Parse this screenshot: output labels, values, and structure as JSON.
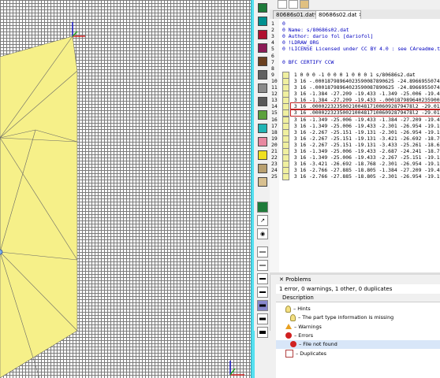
{
  "palette": {
    "colors": [
      "#1e7b3a",
      "#009090",
      "#b01030",
      "#8b1a56",
      "#6b4020",
      "#606060",
      "#8a8a8a",
      "#585858",
      "#5ca03c",
      "#20b4b4",
      "#e888a0",
      "#f0e020",
      "#b8a070",
      "#d8c090"
    ],
    "tools": [
      {
        "name": "green-color-button",
        "color": "#1e7b3a"
      },
      {
        "name": "picker-icon",
        "glyph": "↗"
      },
      {
        "name": "eye-icon",
        "glyph": "◉"
      }
    ],
    "line_widths": [
      1,
      1,
      2,
      2,
      3,
      3,
      4
    ]
  },
  "tabs": [
    {
      "label": "80686s01.dat*",
      "active": false
    },
    {
      "label": "80686s02.dat",
      "active": true
    }
  ],
  "editor": {
    "lines": [
      {
        "n": "1",
        "text": "0",
        "cls": "cmt"
      },
      {
        "n": "2",
        "text": "0 Name: s/80686s02.dat",
        "cls": "cmt"
      },
      {
        "n": "3",
        "text": "0 Author: dario fol [dariofol]",
        "cls": "cmt"
      },
      {
        "n": "4",
        "text": "0 !LDRAW_ORG",
        "cls": "cmt"
      },
      {
        "n": "5",
        "text": "0 !LICENSE Licensed under CC BY 4.0 : see CAreadme.t",
        "cls": "cmt"
      },
      {
        "n": "6",
        "text": "",
        "cls": ""
      },
      {
        "n": "7",
        "text": "0 BFC CERTIFY CCW",
        "cls": "cmt"
      },
      {
        "n": "8",
        "text": "",
        "cls": ""
      },
      {
        "n": "9",
        "text": "1 0 0 0 -1 0 0 0 1 0 0 0 1 s/80686s2.dat",
        "cls": "",
        "box": "1"
      },
      {
        "n": "10",
        "text": "3 16 -.00018798964023590087890625 -24.896695507450",
        "cls": "",
        "box": "3"
      },
      {
        "n": "11",
        "text": "3 16 -.00018798964023590087890625 -24.896695507450",
        "cls": "",
        "box": "3"
      },
      {
        "n": "12",
        "text": "3 16 -1.384 -27.209 -19.433 -1.349 -25.006 -19.433",
        "cls": "",
        "box": "3"
      },
      {
        "n": "13",
        "text": "3 16 -1.384 -27.209 -19.433 -.00018798964023590087",
        "cls": "",
        "box": "3"
      },
      {
        "n": "14",
        "text": "3 16 .000022323500210048171006092879478l2 -29.01568",
        "cls": "hl",
        "box": "3"
      },
      {
        "n": "15",
        "text": "3 16 .000022323500210048171006092879478l2 -29.01568",
        "cls": "hl",
        "box": "3"
      },
      {
        "n": "16",
        "text": "3 16 -1.349 -25.006 -19.433 -1.384 -27.209 -19.433",
        "cls": "",
        "box": "3"
      },
      {
        "n": "17",
        "text": "3 16 -1.349 -25.006 -19.433 -2.301 -26.954 -19.193",
        "cls": "",
        "box": "3"
      },
      {
        "n": "18",
        "text": "3 16 -2.267 -25.151 -19.131 -2.301 -26.954 -19.193",
        "cls": "",
        "box": "3"
      },
      {
        "n": "19",
        "text": "3 16 -2.267 -25.151 -19.131 -3.421 -26.692 -18.768",
        "cls": "",
        "box": "3"
      },
      {
        "n": "20",
        "text": "3 16 -2.267 -25.151 -19.131 -3.433 -25.261 -18.65",
        "cls": "",
        "box": "3"
      },
      {
        "n": "21",
        "text": "3 16 -1.349 -25.006 -19.433 -2.687 -24.241 -18.726",
        "cls": "",
        "box": "3"
      },
      {
        "n": "22",
        "text": "3 16 -1.349 -25.006 -19.433 -2.267 -25.151 -19.131",
        "cls": "",
        "box": "3"
      },
      {
        "n": "23",
        "text": "3 16 -3.421 -26.692 -18.768 -2.301 -26.954 -19.193",
        "cls": "",
        "box": "3"
      },
      {
        "n": "24",
        "text": "3 16 -2.766 -27.885 -18.805 -1.384 -27.209 -19.433",
        "cls": "",
        "box": "3"
      },
      {
        "n": "25",
        "text": "3 16 -2.766 -27.885 -18.805 -2.301 -26.954 -19.193",
        "cls": "",
        "box": "3"
      }
    ]
  },
  "problems": {
    "tab_label": "Problems",
    "summary": "1 error, 0 warnings, 1 other, 0 duplicates",
    "column": "Description",
    "rows": [
      {
        "label": "Hints",
        "icon": "bulb-icon",
        "indent": 1,
        "selected": false
      },
      {
        "label": "The part type information is missing",
        "icon": "bulb-icon",
        "indent": 2,
        "selected": false
      },
      {
        "label": "Warnings",
        "icon": "warning-icon",
        "indent": 1,
        "selected": false
      },
      {
        "label": "Errors",
        "icon": "error-icon",
        "indent": 1,
        "selected": false
      },
      {
        "label": "File not found",
        "icon": "error-icon",
        "indent": 2,
        "selected": true
      },
      {
        "label": "Duplicates",
        "icon": "duplicates-icon",
        "indent": 1,
        "selected": false
      }
    ]
  }
}
